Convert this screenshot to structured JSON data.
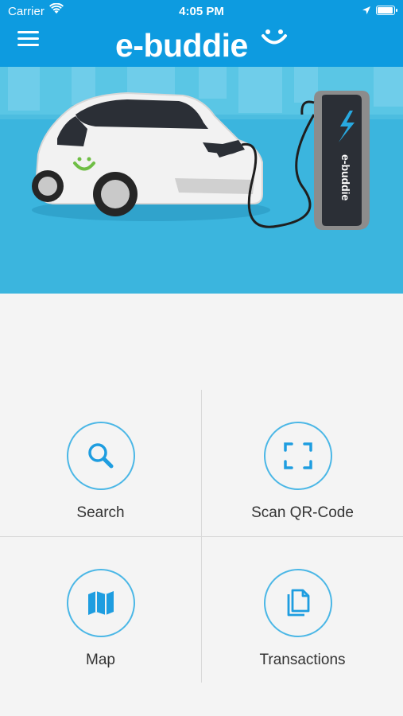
{
  "status_bar": {
    "carrier": "Carrier",
    "time": "4:05 PM",
    "battery_level": 1.0
  },
  "header": {
    "app_name": "e-buddie",
    "menu_icon": "hamburger-menu-icon",
    "background_color": "#0d9be0"
  },
  "hero": {
    "background_color": "#4cbde0",
    "station_label": "e-buddie",
    "car_badge_color": "#6fbe45"
  },
  "actions": [
    {
      "label": "Search",
      "icon": "search-icon"
    },
    {
      "label": "Scan QR-Code",
      "icon": "qr-scan-icon"
    },
    {
      "label": "Map",
      "icon": "map-icon"
    },
    {
      "label": "Transactions",
      "icon": "documents-icon"
    }
  ],
  "accent_color": "#1e9de0"
}
